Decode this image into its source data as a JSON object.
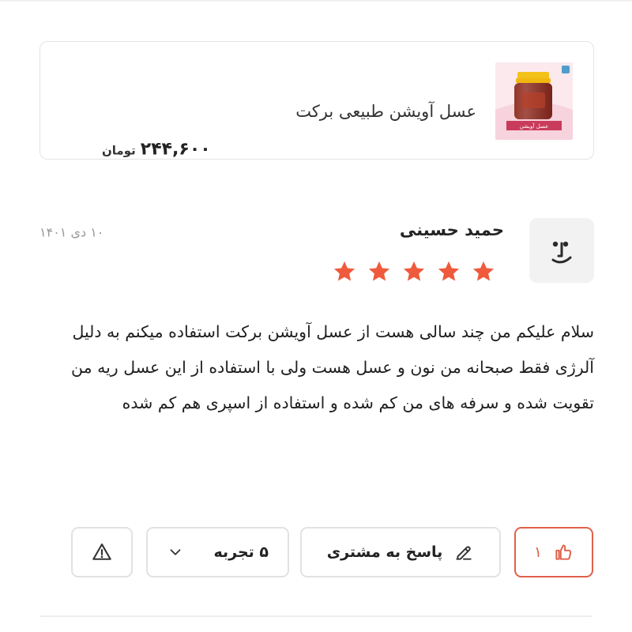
{
  "product": {
    "title": "عسل آویشن طبیعی برکت",
    "price": "۲۴۴,۶۰۰",
    "currency": "تومان",
    "thumbnail_label": "عسل آویشن"
  },
  "review": {
    "reviewer_name": "حمید حسینی",
    "date": "۱۰ دی ۱۴۰۱",
    "rating": 5,
    "max_rating": 5,
    "body": "سلام علیکم من چند سالی هست از عسل آویشن برکت استفاده میکنم به دلیل آلرژی فقط صبحانه من نون و عسل هست ولی با استفاده از این عسل ریه من تقویت شده و سرفه های من کم شده و استفاده از اسپری هم کم شده"
  },
  "actions": {
    "like_count": "۱",
    "reply_label": "پاسخ به مشتری",
    "experience_label": "۵ تجربه",
    "report_icon": "warning-icon"
  },
  "colors": {
    "accent": "#e0604a",
    "star": "#ef5a3c",
    "border": "#e2e2e2",
    "muted_text": "#9a9a9a"
  },
  "icons": {
    "like": "thumbs-up-icon",
    "reply": "pencil-icon",
    "expand": "chevron-down-icon",
    "avatar": "smiley-face-icon",
    "star": "star-icon"
  }
}
